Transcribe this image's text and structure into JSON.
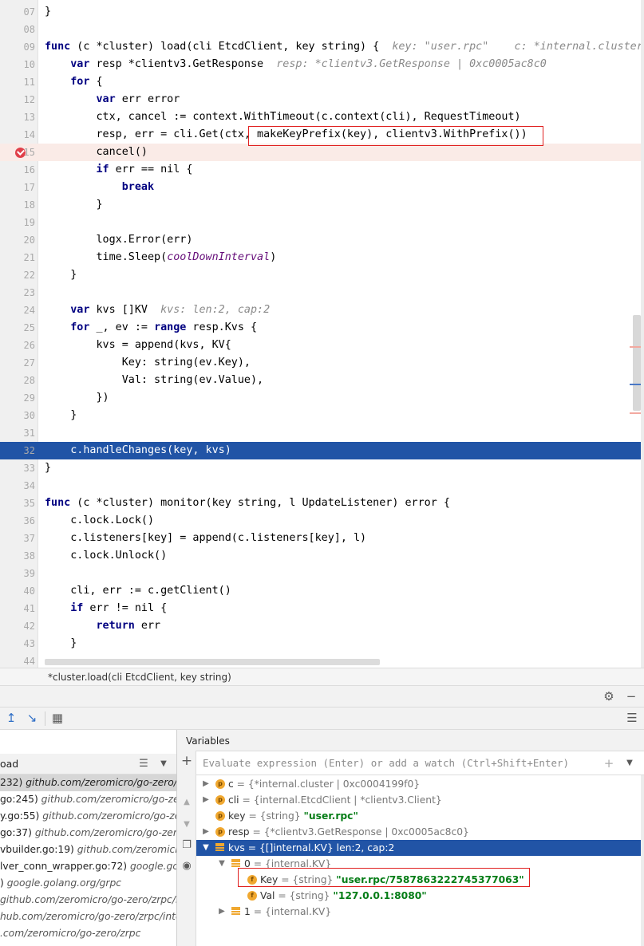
{
  "editor": {
    "lines": [
      {
        "num": "07",
        "code": [
          {
            "t": "}"
          }
        ]
      },
      {
        "num": "08",
        "code": []
      },
      {
        "num": "09",
        "code": [
          {
            "t": "func",
            "c": "kw"
          },
          {
            "t": " (c *cluster) load(cli EtcdClient, key string) {  "
          },
          {
            "t": "key: \"user.rpc\"    c: *internal.cluster",
            "c": "cm"
          }
        ]
      },
      {
        "num": "10",
        "code": [
          {
            "t": "    "
          },
          {
            "t": "var",
            "c": "kw"
          },
          {
            "t": " resp *clientv3.GetResponse  "
          },
          {
            "t": "resp: *clientv3.GetResponse | 0xc0005ac8c0",
            "c": "cm"
          }
        ]
      },
      {
        "num": "11",
        "code": [
          {
            "t": "    "
          },
          {
            "t": "for",
            "c": "kw"
          },
          {
            "t": " {"
          }
        ]
      },
      {
        "num": "12",
        "code": [
          {
            "t": "        "
          },
          {
            "t": "var",
            "c": "kw"
          },
          {
            "t": " err error"
          }
        ]
      },
      {
        "num": "13",
        "code": [
          {
            "t": "        ctx, cancel := context.WithTimeout(c.context(cli), RequestTimeout)"
          }
        ]
      },
      {
        "num": "14",
        "code": [
          {
            "t": "        resp, err = cli.Get(ctx, makeKeyPrefix(key), clientv3.WithPrefix())"
          }
        ]
      },
      {
        "num": "15",
        "code": [
          {
            "t": "        cancel()"
          }
        ],
        "style": "break"
      },
      {
        "num": "16",
        "code": [
          {
            "t": "        "
          },
          {
            "t": "if",
            "c": "kw"
          },
          {
            "t": " err == nil {"
          }
        ]
      },
      {
        "num": "17",
        "code": [
          {
            "t": "            "
          },
          {
            "t": "break",
            "c": "kw"
          }
        ]
      },
      {
        "num": "18",
        "code": [
          {
            "t": "        }"
          }
        ]
      },
      {
        "num": "19",
        "code": []
      },
      {
        "num": "20",
        "code": [
          {
            "t": "        logx.Error(err)"
          }
        ]
      },
      {
        "num": "21",
        "code": [
          {
            "t": "        time.Sleep("
          },
          {
            "t": "coolDownInterval",
            "c": "it"
          },
          {
            "t": ")"
          }
        ]
      },
      {
        "num": "22",
        "code": [
          {
            "t": "    }"
          }
        ]
      },
      {
        "num": "23",
        "code": []
      },
      {
        "num": "24",
        "code": [
          {
            "t": "    "
          },
          {
            "t": "var",
            "c": "kw"
          },
          {
            "t": " kvs []KV  "
          },
          {
            "t": "kvs: len:2, cap:2",
            "c": "cm"
          }
        ]
      },
      {
        "num": "25",
        "code": [
          {
            "t": "    "
          },
          {
            "t": "for",
            "c": "kw"
          },
          {
            "t": " _, ev := "
          },
          {
            "t": "range",
            "c": "kw"
          },
          {
            "t": " resp.Kvs {"
          }
        ]
      },
      {
        "num": "26",
        "code": [
          {
            "t": "        kvs = append(kvs, KV{"
          }
        ]
      },
      {
        "num": "27",
        "code": [
          {
            "t": "            Key: string(ev.Key),"
          }
        ]
      },
      {
        "num": "28",
        "code": [
          {
            "t": "            Val: string(ev.Value),"
          }
        ]
      },
      {
        "num": "29",
        "code": [
          {
            "t": "        })"
          }
        ]
      },
      {
        "num": "30",
        "code": [
          {
            "t": "    }"
          }
        ]
      },
      {
        "num": "31",
        "code": []
      },
      {
        "num": "32",
        "code": [
          {
            "t": "    c.handleChanges(key, kvs)"
          }
        ],
        "style": "exec"
      },
      {
        "num": "33",
        "code": [
          {
            "t": "}"
          }
        ]
      },
      {
        "num": "34",
        "code": []
      },
      {
        "num": "35",
        "code": [
          {
            "t": "func",
            "c": "kw"
          },
          {
            "t": " (c *cluster) monitor(key string, l UpdateListener) error {"
          }
        ]
      },
      {
        "num": "36",
        "code": [
          {
            "t": "    c.lock.Lock()"
          }
        ]
      },
      {
        "num": "37",
        "code": [
          {
            "t": "    c.listeners[key] = append(c.listeners[key], l)"
          }
        ]
      },
      {
        "num": "38",
        "code": [
          {
            "t": "    c.lock.Unlock()"
          }
        ]
      },
      {
        "num": "39",
        "code": []
      },
      {
        "num": "40",
        "code": [
          {
            "t": "    cli, err := c.getClient()"
          }
        ]
      },
      {
        "num": "41",
        "code": [
          {
            "t": "    "
          },
          {
            "t": "if",
            "c": "kw"
          },
          {
            "t": " err != nil {"
          }
        ]
      },
      {
        "num": "42",
        "code": [
          {
            "t": "        "
          },
          {
            "t": "return",
            "c": "kw"
          },
          {
            "t": " err"
          }
        ]
      },
      {
        "num": "43",
        "code": [
          {
            "t": "    }"
          }
        ]
      },
      {
        "num": "44",
        "code": []
      }
    ]
  },
  "breadcrumb": "*cluster.load(cli EtcdClient, key string)",
  "frames": {
    "header_label": "oad",
    "rows": [
      {
        "loc": "232)",
        "path": " github.com/zeromicro/go-zero/co",
        "selected": true
      },
      {
        "loc": "go:245)",
        "path": " github.com/zeromicro/go-zero"
      },
      {
        "loc": "y.go:55)",
        "path": " github.com/zeromicro/go-zer"
      },
      {
        "loc": "go:37)",
        "path": " github.com/zeromicro/go-zero"
      },
      {
        "loc": "vbuilder.go:19)",
        "path": " github.com/zeromicro/"
      },
      {
        "loc": "lver_conn_wrapper.go:72)",
        "path": " google.gola"
      },
      {
        "loc": ")",
        "path": " google.golang.org/grpc"
      },
      {
        "loc": "",
        "path": "github.com/zeromicro/go-zero/zrpc/in"
      },
      {
        "loc": "",
        "path": "hub.com/zeromicro/go-zero/zrpc/inte"
      },
      {
        "loc": "",
        "path": ".com/zeromicro/go-zero/zrpc"
      }
    ]
  },
  "variables": {
    "title": "Variables",
    "eval_placeholder": "Evaluate expression (Enter) or add a watch (Ctrl+Shift+Enter)",
    "rows": [
      {
        "arrow": "▶",
        "icon": "p",
        "name": "c",
        "meta": " = {*internal.cluster | 0xc0004199f0}"
      },
      {
        "arrow": "▶",
        "icon": "p",
        "name": "cli",
        "meta": " = {internal.EtcdClient | *clientv3.Client}"
      },
      {
        "arrow": "",
        "icon": "p",
        "name": "key",
        "meta": " = {string} ",
        "str": "\"user.rpc\""
      },
      {
        "arrow": "▶",
        "icon": "p",
        "name": "resp",
        "meta": " = {*clientv3.GetResponse | 0xc0005ac8c0}"
      },
      {
        "arrow": "▼",
        "icon": "list",
        "name": "kvs",
        "meta": " = {[]internal.KV} len:2, cap:2",
        "selected": true
      },
      {
        "arrow": "▼",
        "icon": "list",
        "name": "0",
        "meta": " = {internal.KV}"
      },
      {
        "arrow": "",
        "icon": "f",
        "name": "Key",
        "meta": " = {string} ",
        "str": "\"user.rpc/7587863222745377063\""
      },
      {
        "arrow": "",
        "icon": "f",
        "name": "Val",
        "meta": " = {string} ",
        "str": "\"127.0.0.1:8080\""
      },
      {
        "arrow": "▶",
        "icon": "list",
        "name": "1",
        "meta": " = {internal.KV}"
      }
    ]
  }
}
